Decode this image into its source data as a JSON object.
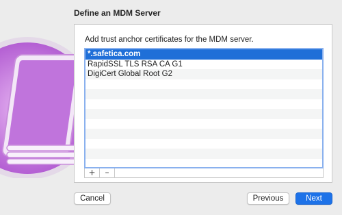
{
  "sheet": {
    "title": "Define an MDM Server"
  },
  "panel": {
    "instruction": "Add trust anchor certificates for the MDM server."
  },
  "certificates": [
    {
      "label": "*.safetica.com",
      "selected": true
    },
    {
      "label": "RapidSSL TLS RSA CA G1",
      "selected": false
    },
    {
      "label": "DigiCert Global Root G2",
      "selected": false
    }
  ],
  "stepper": {
    "add_label": "+",
    "remove_label": "–"
  },
  "buttons": {
    "cancel": "Cancel",
    "previous": "Previous",
    "next": "Next"
  },
  "colors": {
    "accent": "#1d72e8",
    "selection": "#1f6fd8",
    "list_focus": "#8ab1ee",
    "artwork": "#b45fd3"
  },
  "icons": {
    "artwork": "ipad-stack-icon"
  }
}
